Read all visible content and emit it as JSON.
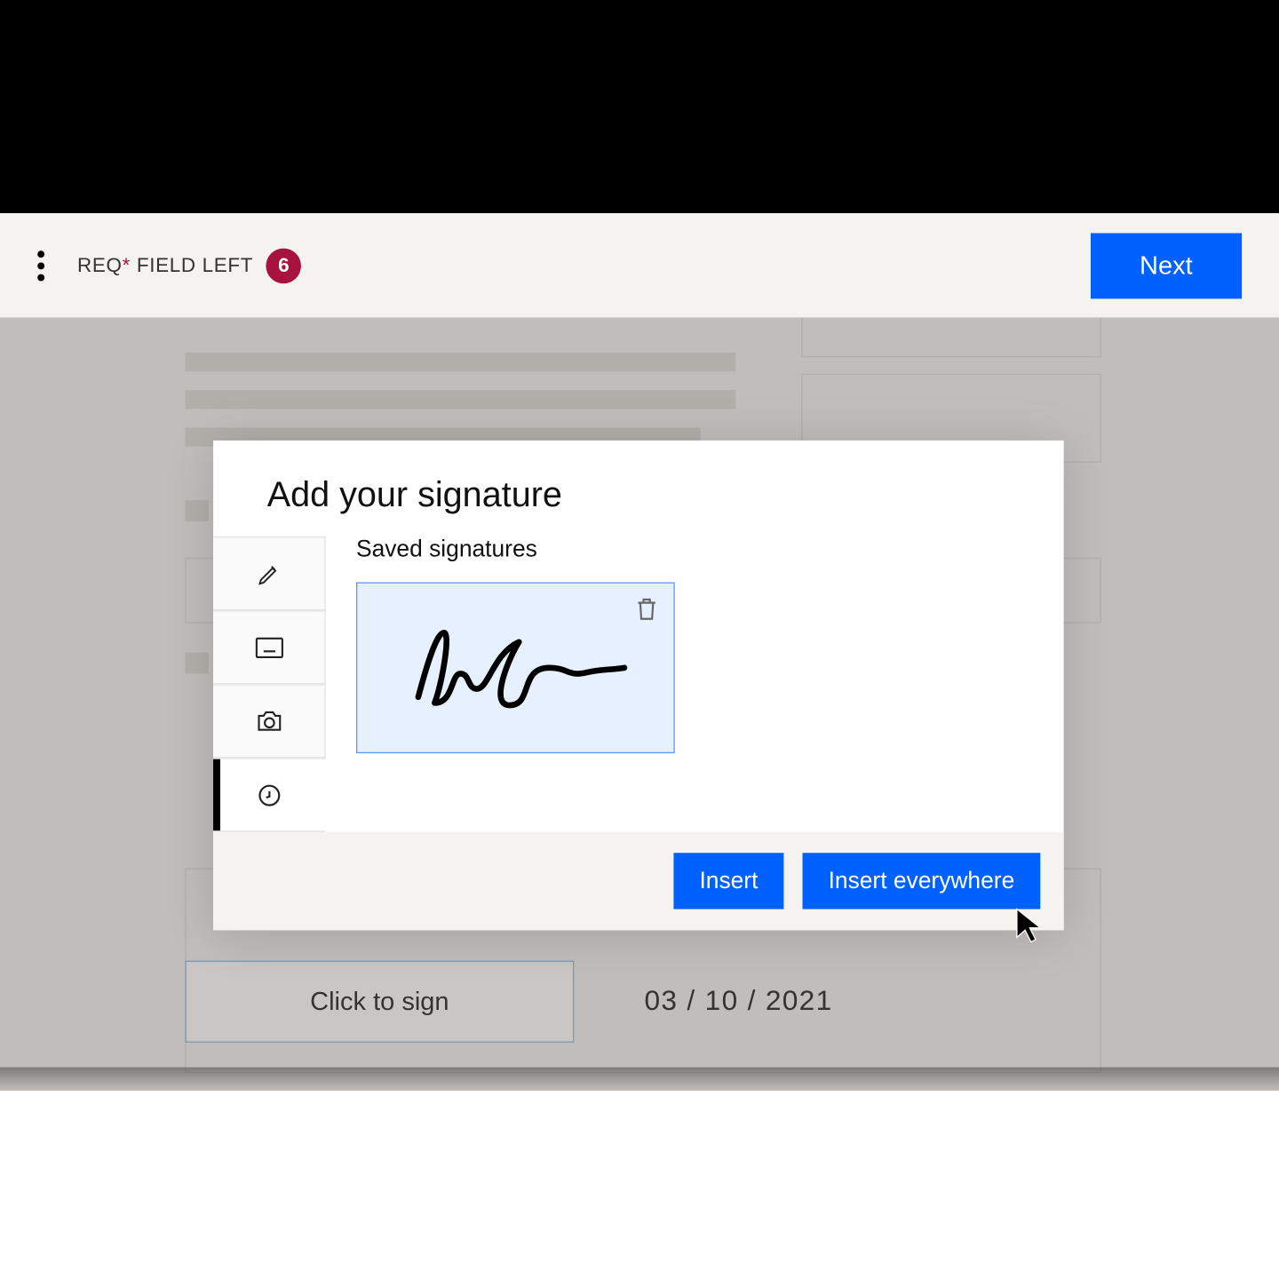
{
  "header": {
    "req_label_prefix": "REQ",
    "req_label_suffix": " FIELD LEFT",
    "req_asterisk": "*",
    "badge_count": "6",
    "next_label": "Next"
  },
  "doc": {
    "click_to_sign": "Click to sign",
    "date": "03 / 10 / 2021"
  },
  "modal": {
    "title": "Add your signature",
    "subtitle": "Saved signatures",
    "tabs": {
      "draw": "pencil-icon",
      "type": "keyboard-icon",
      "upload": "camera-icon",
      "saved": "clock-icon"
    },
    "insert_label": "Insert",
    "insert_everywhere_label": "Insert everywhere"
  }
}
